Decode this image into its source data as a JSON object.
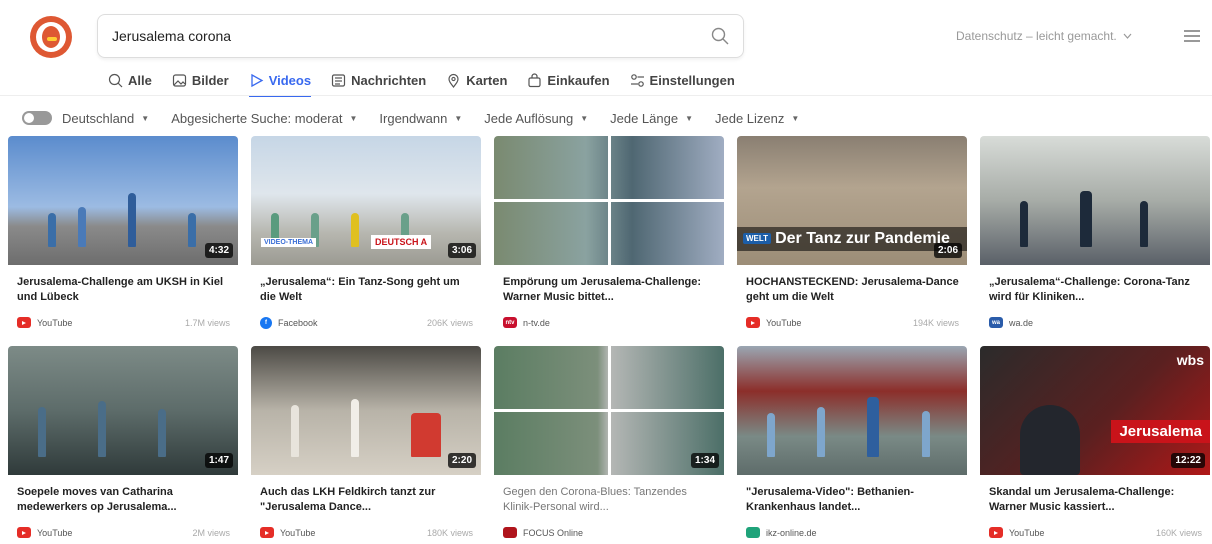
{
  "search": {
    "query": "Jerusalema corona"
  },
  "header": {
    "privacy_label": "Datenschutz – leicht gemacht."
  },
  "tabs": [
    {
      "label": "Alle",
      "icon": "search-icon"
    },
    {
      "label": "Bilder",
      "icon": "image-icon"
    },
    {
      "label": "Videos",
      "icon": "play-icon",
      "active": true
    },
    {
      "label": "Nachrichten",
      "icon": "newspaper-icon"
    },
    {
      "label": "Karten",
      "icon": "map-pin-icon"
    },
    {
      "label": "Einkaufen",
      "icon": "shopping-bag-icon"
    },
    {
      "label": "Einstellungen",
      "icon": "settings-icon"
    }
  ],
  "filters": {
    "region": "Deutschland",
    "safe_search": "Abgesicherte Suche: moderat",
    "time": "Irgendwann",
    "resolution": "Jede Auflösung",
    "length": "Jede Länge",
    "license": "Jede Lizenz"
  },
  "videos": [
    {
      "title": "Jerusalema-Challenge am UKSH in Kiel und Lübeck",
      "duration": "4:32",
      "source": "YouTube",
      "views": "1.7M views"
    },
    {
      "title": "„Jerusalema“: Ein Tanz-Song geht um die Welt",
      "duration": "3:06",
      "source": "Facebook",
      "views": "206K views",
      "thema": "VIDEO-THEMA",
      "dtag": "DEUTSCH A"
    },
    {
      "title": "Empörung um Jerusalema-Challenge: Warner Music bittet...",
      "duration": "",
      "source": "n-tv.de",
      "views": ""
    },
    {
      "title": "HOCHANSTECKEND: Jerusalema-Dance geht um die Welt",
      "duration": "2:06",
      "source": "YouTube",
      "views": "194K views",
      "overlay": "Der Tanz zur Pandemie",
      "badge": "WELT"
    },
    {
      "title": "„Jerusalema“-Challenge: Corona-Tanz wird für Kliniken...",
      "duration": "",
      "source": "wa.de",
      "views": ""
    },
    {
      "title": "Soepele moves van Catharina medewerkers op Jerusalema...",
      "duration": "1:47",
      "source": "YouTube",
      "views": "2M views"
    },
    {
      "title": "Auch das LKH Feldkirch tanzt zur \"Jerusalema Dance...",
      "duration": "2:20",
      "source": "YouTube",
      "views": "180K views"
    },
    {
      "title": "Gegen den Corona-Blues: Tanzendes Klinik-Personal wird...",
      "duration": "1:34",
      "source": "FOCUS Online",
      "views": ""
    },
    {
      "title": "\"Jerusalema-Video\": Bethanien-Krankenhaus landet...",
      "duration": "",
      "source": "ikz-online.de",
      "views": ""
    },
    {
      "title": "Skandal um Jerusalema-Challenge: Warner Music kassiert...",
      "duration": "12:22",
      "source": "YouTube",
      "views": "160K views",
      "overlay": "Jerusalema",
      "brand": "wbs"
    }
  ]
}
